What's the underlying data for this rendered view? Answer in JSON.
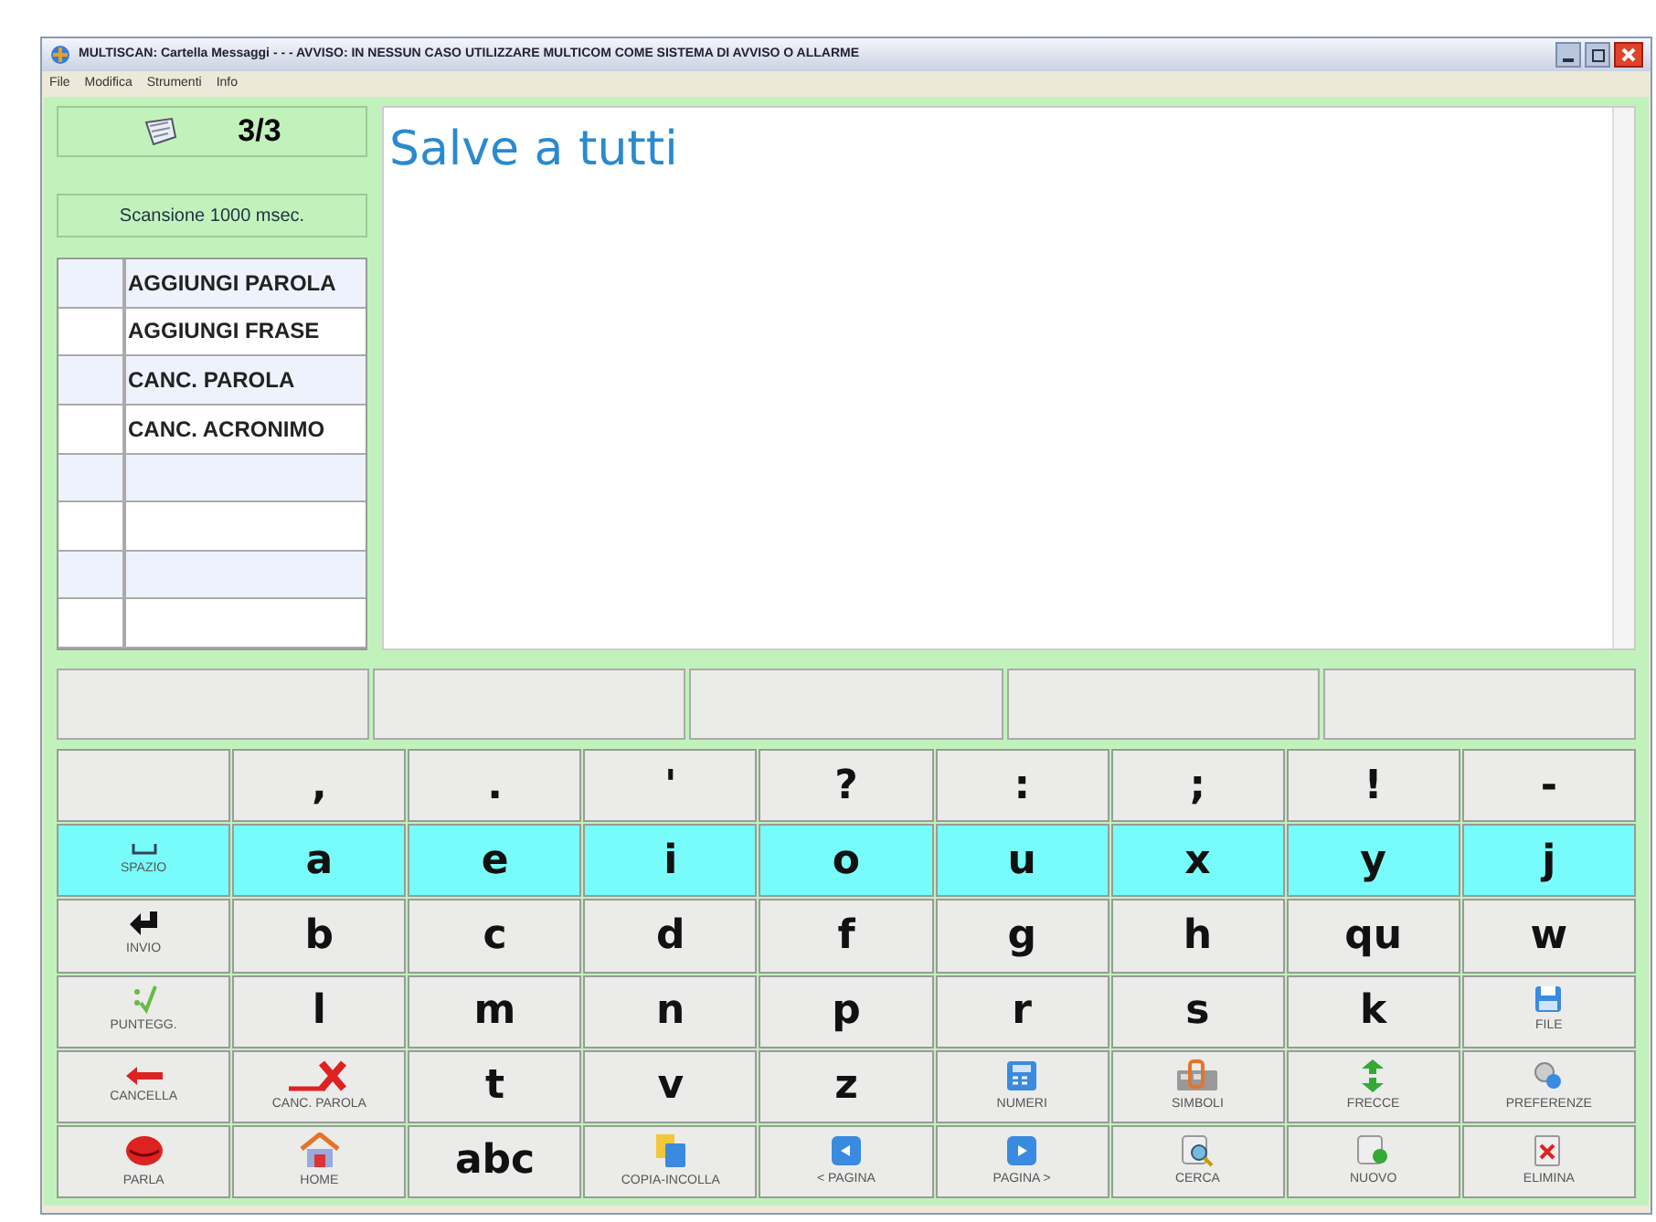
{
  "window": {
    "title": "MULTISCAN: Cartella Messaggi - - - AVVISO: IN NESSUN CASO UTILIZZARE MULTICOM COME SISTEMA DI AVVISO O ALLARME"
  },
  "menu": [
    "File",
    "Modifica",
    "Strumenti",
    "Info"
  ],
  "page_counter": "3/3",
  "scan_speed": "Scansione 1000 msec.",
  "commands": [
    "AGGIUNGI PAROLA",
    "AGGIUNGI FRASE",
    "CANC. PAROLA",
    "CANC. ACRONIMO"
  ],
  "message_text": "Salve a tutti",
  "keyboard": [
    {
      "highlighted": false,
      "keys": [
        {
          "kind": "blank"
        },
        {
          "kind": "char",
          "label": ","
        },
        {
          "kind": "char",
          "label": "."
        },
        {
          "kind": "char",
          "label": "'"
        },
        {
          "kind": "char",
          "label": "?"
        },
        {
          "kind": "char",
          "label": ":"
        },
        {
          "kind": "char",
          "label": ";"
        },
        {
          "kind": "char",
          "label": "!"
        },
        {
          "kind": "char",
          "label": "-"
        }
      ]
    },
    {
      "highlighted": true,
      "keys": [
        {
          "kind": "icon",
          "label": "SPAZIO"
        },
        {
          "kind": "char",
          "label": "a"
        },
        {
          "kind": "char",
          "label": "e"
        },
        {
          "kind": "char",
          "label": "i"
        },
        {
          "kind": "char",
          "label": "o"
        },
        {
          "kind": "char",
          "label": "u"
        },
        {
          "kind": "char",
          "label": "x"
        },
        {
          "kind": "char",
          "label": "y"
        },
        {
          "kind": "char",
          "label": "j"
        }
      ]
    },
    {
      "highlighted": false,
      "keys": [
        {
          "kind": "icon",
          "label": "INVIO"
        },
        {
          "kind": "char",
          "label": "b"
        },
        {
          "kind": "char",
          "label": "c"
        },
        {
          "kind": "char",
          "label": "d"
        },
        {
          "kind": "char",
          "label": "f"
        },
        {
          "kind": "char",
          "label": "g"
        },
        {
          "kind": "char",
          "label": "h"
        },
        {
          "kind": "char",
          "label": "qu"
        },
        {
          "kind": "char",
          "label": "w"
        }
      ]
    },
    {
      "highlighted": false,
      "keys": [
        {
          "kind": "icon",
          "label": "PUNTEGG."
        },
        {
          "kind": "char",
          "label": "l"
        },
        {
          "kind": "char",
          "label": "m"
        },
        {
          "kind": "char",
          "label": "n"
        },
        {
          "kind": "char",
          "label": "p"
        },
        {
          "kind": "char",
          "label": "r"
        },
        {
          "kind": "char",
          "label": "s"
        },
        {
          "kind": "char",
          "label": "k"
        },
        {
          "kind": "icon",
          "label": "FILE"
        }
      ]
    },
    {
      "highlighted": false,
      "keys": [
        {
          "kind": "icon",
          "label": "CANCELLA"
        },
        {
          "kind": "icon",
          "label": "CANC. PAROLA"
        },
        {
          "kind": "char",
          "label": "t"
        },
        {
          "kind": "char",
          "label": "v"
        },
        {
          "kind": "char",
          "label": "z"
        },
        {
          "kind": "icon",
          "label": "NUMERI"
        },
        {
          "kind": "icon",
          "label": "SIMBOLI"
        },
        {
          "kind": "icon",
          "label": "FRECCE"
        },
        {
          "kind": "icon",
          "label": "PREFERENZE"
        }
      ]
    },
    {
      "highlighted": false,
      "keys": [
        {
          "kind": "icon",
          "label": "PARLA"
        },
        {
          "kind": "icon",
          "label": "HOME"
        },
        {
          "kind": "char",
          "label": "abc"
        },
        {
          "kind": "icon",
          "label": "COPIA-INCOLLA"
        },
        {
          "kind": "icon",
          "label": "< PAGINA"
        },
        {
          "kind": "icon",
          "label": "PAGINA >"
        },
        {
          "kind": "icon",
          "label": "CERCA"
        },
        {
          "kind": "icon",
          "label": "NUOVO"
        },
        {
          "kind": "icon",
          "label": "ELIMINA"
        }
      ]
    }
  ]
}
